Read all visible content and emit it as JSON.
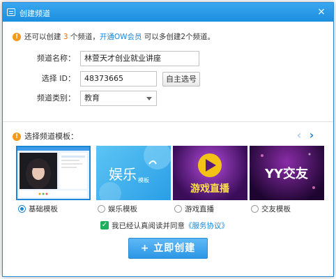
{
  "window": {
    "title": "创建频道",
    "close_glyph": "×"
  },
  "notice": {
    "prefix": "还可以创建",
    "count": "3",
    "middle": "个频道，",
    "link": "开通OW会员",
    "suffix": "可以多创建2个频道。"
  },
  "form": {
    "name_label": "频道名称：",
    "name_value": "林萱天才创业就业讲座",
    "id_label": "选择 ID：",
    "id_value": "48373665",
    "self_select_button": "自主选号",
    "category_label": "频道类别：",
    "category_value": "教育"
  },
  "templates": {
    "heading": "选择频道模板：",
    "prev_glyph": "‹",
    "next_glyph": "›",
    "items": [
      {
        "label": "基础模板",
        "selected": true
      },
      {
        "label": "娱乐模板",
        "thumb_text": "娱乐",
        "thumb_small": "模板",
        "selected": false
      },
      {
        "label": "游戏直播",
        "thumb_text": "游戏直播",
        "selected": false
      },
      {
        "label": "交友模板",
        "thumb_text": "YY交友",
        "selected": false
      }
    ]
  },
  "agreement": {
    "text": "我已经认真阅读并同意",
    "link": "《服务协议》"
  },
  "create_button": {
    "icon": "+",
    "label": "立即创建"
  },
  "colors": {
    "accent": "#1b86d8",
    "title_bar": "#1c8fe0",
    "warning": "#f39a1b",
    "check": "#1fae5b"
  }
}
